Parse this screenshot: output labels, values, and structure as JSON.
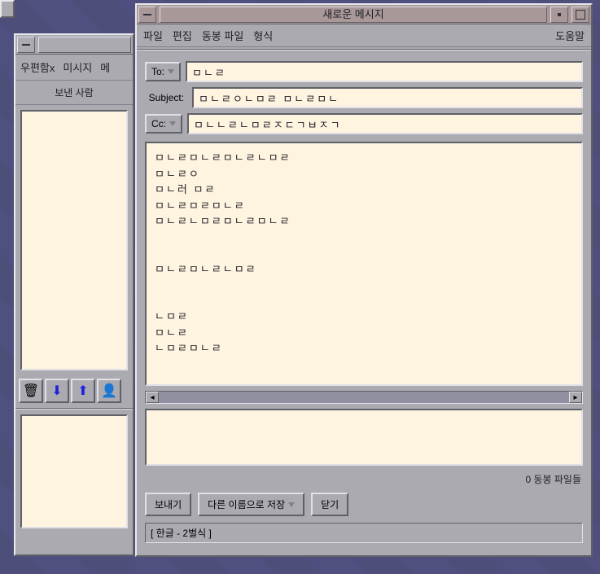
{
  "mailbox": {
    "menu": [
      "우편함x",
      "미시지",
      "메"
    ],
    "sender_label": "보낸 사람",
    "icons": [
      "trash",
      "down",
      "up",
      "user"
    ]
  },
  "compose": {
    "title": "새로운 메시지",
    "menu": [
      "파일",
      "편집",
      "동봉 파일",
      "형식"
    ],
    "help": "도움말",
    "fields": {
      "to_label": "To:",
      "to_value": "ㅁㄴㄹ",
      "subject_label": "Subject:",
      "subject_value": "ㅁㄴㄹㅇㄴㅁㄹ ㅁㄴㄹㅁㄴ",
      "cc_label": "Cc:",
      "cc_value": "ㅁㄴㄴㄹㄴㅁㄹㅈㄷㄱㅂㅈㄱ"
    },
    "body": "ㅁㄴㄹㅁㄴㄹㅁㄴㄹㄴㅁㄹ\nㅁㄴㄹㅇ\nㅁㄴ러 ㅁㄹ\nㅁㄴㄹㅁㄹㅁㄴㄹ\nㅁㄴㄹㄴㅁㄹㅁㄴㄹㅁㄴㄹ\n\n\nㅁㄴㄹㅁㄴㄹㄴㅁㄹ\n\n\nㄴㅁㄹ\nㅁㄴㄹ\nㄴㅁㄹㅁㄴㄹ",
    "attach_status": "0 동봉 파일들",
    "buttons": {
      "send": "보내기",
      "save_as": "다른 이름으로 저장",
      "close": "닫기"
    },
    "status": "[ 한글 - 2벌식 ]"
  }
}
